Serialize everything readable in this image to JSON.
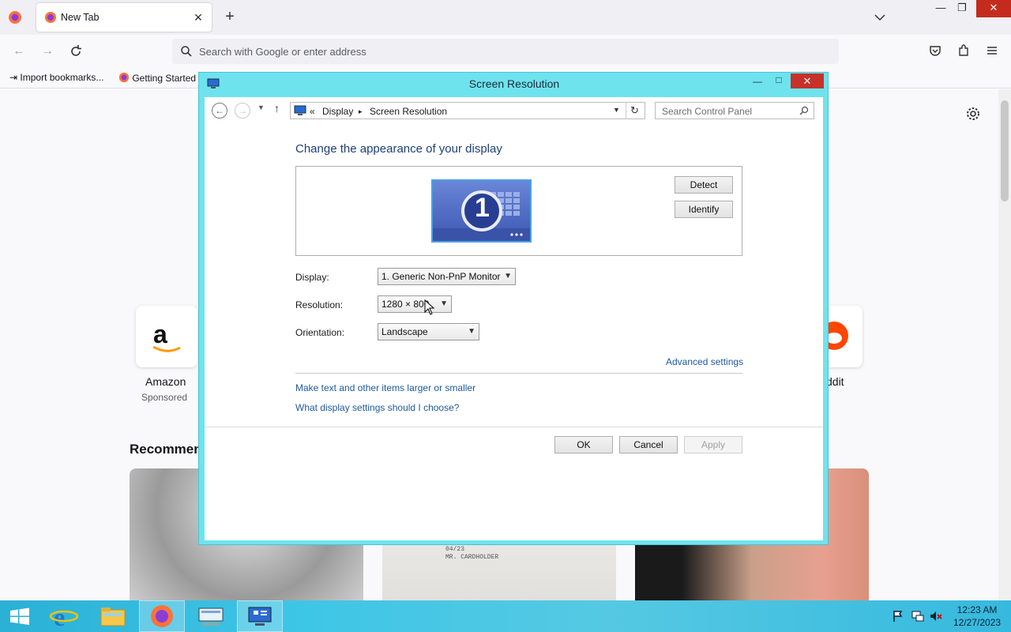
{
  "browser": {
    "tab": {
      "title": "New Tab",
      "close": "✕"
    },
    "new_tab": "+",
    "url_placeholder": "Search with Google or enter address",
    "bookmarks": [
      "Import bookmarks...",
      "Getting Started"
    ],
    "window_controls": {
      "minimize": "—",
      "restore": "❐",
      "close": "✕"
    }
  },
  "newtab_page": {
    "shortcuts": [
      {
        "label": "Amazon",
        "sub": "Sponsored"
      },
      {
        "label": "ddit",
        "sub": ""
      }
    ],
    "recommended_heading": "Recommen",
    "card_texts": [
      "04/23",
      "MR. CARDHOLDER"
    ]
  },
  "dialog": {
    "title": "Screen Resolution",
    "controls": {
      "minimize": "—",
      "maximize": "□",
      "close": "✕"
    },
    "breadcrumb": {
      "sep": "«",
      "items": [
        "Display",
        "Screen Resolution"
      ],
      "arrow": "▸"
    },
    "search_placeholder": "Search Control Panel",
    "heading": "Change the appearance of your display",
    "monitor_number": "1",
    "buttons": {
      "detect": "Detect",
      "identify": "Identify",
      "ok": "OK",
      "cancel": "Cancel",
      "apply": "Apply"
    },
    "fields": {
      "display_label": "Display:",
      "display_value": "1. Generic Non-PnP Monitor",
      "resolution_label": "Resolution:",
      "resolution_value": "1280 × 800",
      "orientation_label": "Orientation:",
      "orientation_value": "Landscape"
    },
    "links": {
      "advanced": "Advanced settings",
      "larger": "Make text and other items larger or smaller",
      "which": "What display settings should I choose?"
    }
  },
  "taskbar": {
    "clock_time": "12:23 AM",
    "clock_date": "12/27/2023"
  },
  "colors": {
    "dialog_frame": "#6ee3ee",
    "link": "#1e5aa0",
    "close_red": "#c42b1c",
    "taskbar": "#3ec6e6"
  }
}
